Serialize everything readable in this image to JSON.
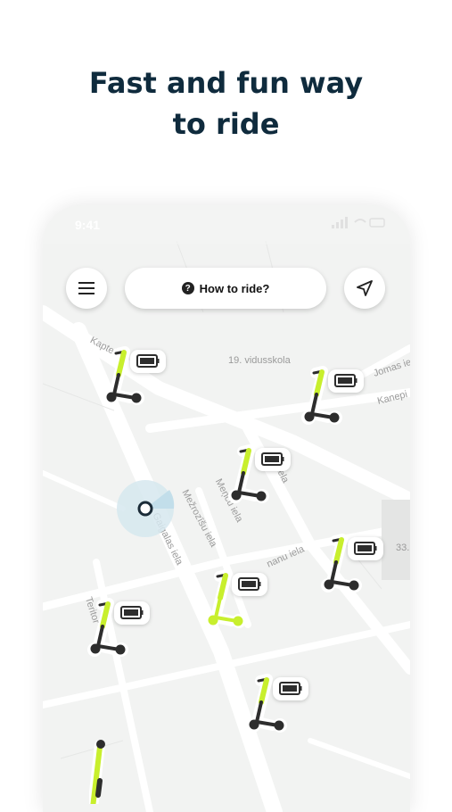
{
  "headline": {
    "line1": "Fast and fun way",
    "line2": "to ride"
  },
  "status_bar": {
    "time": "9:41"
  },
  "top_bar": {
    "menu_icon": "hamburger-menu-icon",
    "help_label": "How to ride?",
    "help_icon": "question-icon",
    "locate_icon": "navigation-arrow-icon"
  },
  "map": {
    "streets": [
      {
        "name": "Kaptei"
      },
      {
        "name": "19. vidusskola"
      },
      {
        "name": "Jomas iel"
      },
      {
        "name": "Kanepi"
      },
      {
        "name": "Mežrozīšu iela"
      },
      {
        "name": "Meņcu iela"
      },
      {
        "name": "Gaigalas iela"
      },
      {
        "name": "nanu iela"
      },
      {
        "name": "Teritor"
      },
      {
        "name": "33."
      },
      {
        "name": "ela"
      }
    ],
    "scooter_icon": "scooter-icon",
    "battery_icon": "battery-icon",
    "user_location_icon": "user-location-icon",
    "colors": {
      "accent": "#c8ef2d",
      "dark": "#2d2d2d",
      "map_bg": "#f2f3f2",
      "road": "#ffffff"
    }
  }
}
